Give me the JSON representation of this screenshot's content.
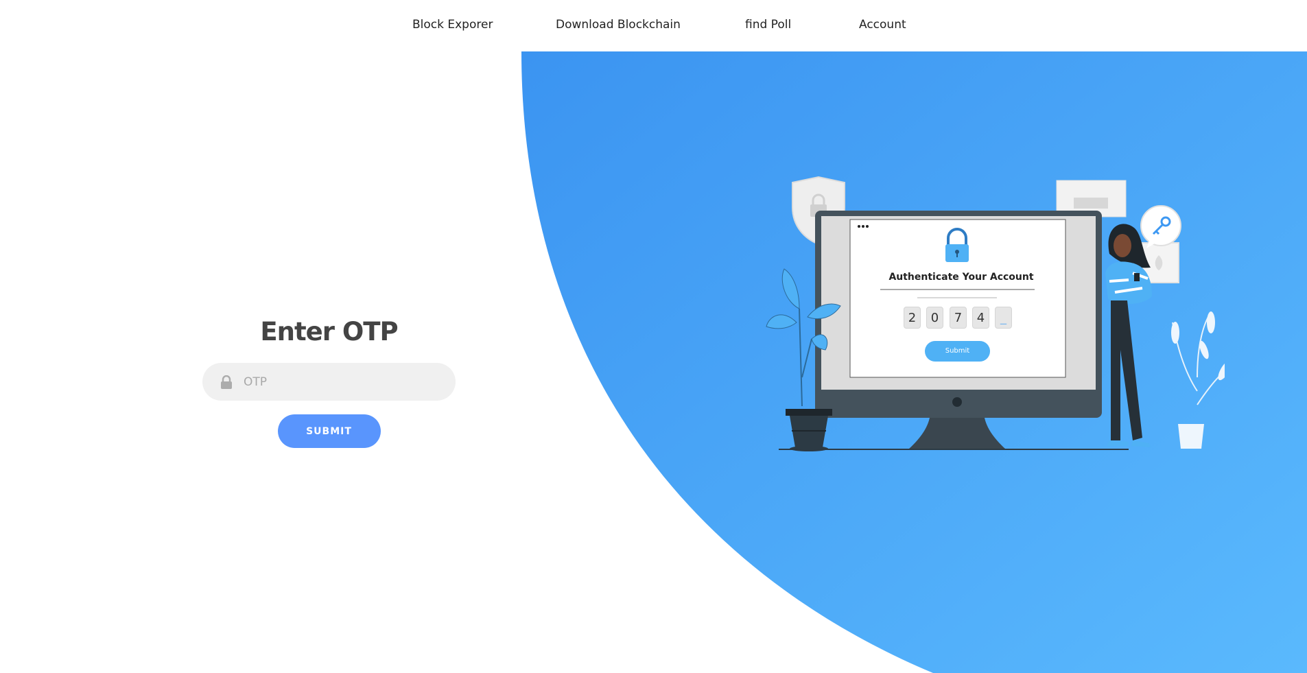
{
  "nav": {
    "items": [
      {
        "label": "Block Exporer"
      },
      {
        "label": "Download Blockchain"
      },
      {
        "label": "find Poll"
      },
      {
        "label": "Account"
      }
    ]
  },
  "form": {
    "title": "Enter OTP",
    "otp_input": {
      "placeholder": "OTP",
      "value": ""
    },
    "submit_label": "SUBMIT",
    "lock_icon": "lock-icon"
  },
  "illustration": {
    "screen_title": "Authenticate Your Account",
    "otp_digits": [
      "2",
      "0",
      "7",
      "4",
      "_"
    ],
    "submit_label": "Submit",
    "icons": [
      "padlock-icon",
      "shield-lock-icon",
      "key-icon",
      "plant-icon",
      "leaf-frame-icon",
      "window-dots-icon"
    ]
  },
  "colors": {
    "accent": "#5995fd",
    "blue_gradient_start": "#3d98f2",
    "blue_gradient_end": "#5ab8fd",
    "input_bg": "#f0f0f0",
    "monitor_frame": "#44525c"
  }
}
